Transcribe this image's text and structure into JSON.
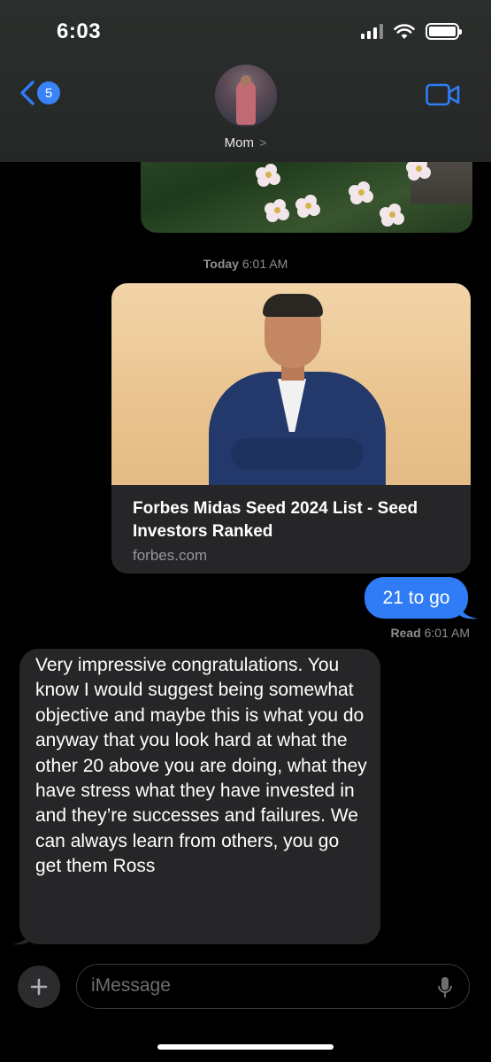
{
  "status_bar": {
    "time": "6:03"
  },
  "header": {
    "back_count": "5",
    "contact_name": "Mom",
    "chevron": ">"
  },
  "thread": {
    "timestamp_day": "Today",
    "timestamp_time": "6:01 AM",
    "link_preview": {
      "title": "Forbes Midas Seed 2024 List - Seed Investors Ranked",
      "domain": "forbes.com"
    },
    "sent_message": "21 to go",
    "read_label": "Read",
    "read_time": "6:01 AM",
    "received_message": "Very impressive congratulations. You know I would suggest being somewhat objective and maybe this is what you do anyway that you look hard at what the other 20 above you are doing, what they have stress what they have invested in and they’re successes and failures. We can always learn from others, you go get them Ross"
  },
  "composer": {
    "placeholder": "iMessage"
  },
  "colors": {
    "accent": "#2f7cf6",
    "bubble_gray": "#262628",
    "background": "#000000"
  }
}
